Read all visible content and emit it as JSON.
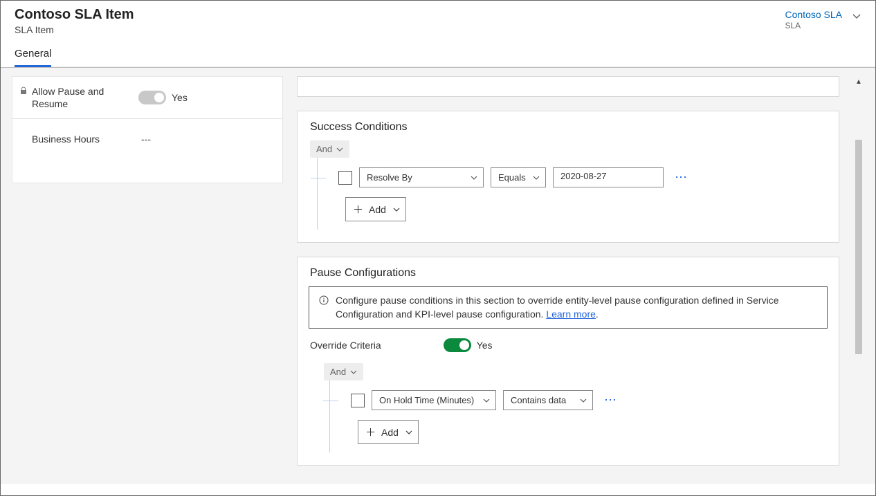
{
  "header": {
    "title": "Contoso SLA Item",
    "subtitle": "SLA Item",
    "sla_link": "Contoso SLA",
    "sla_type": "SLA"
  },
  "tabs": {
    "general": "General"
  },
  "side": {
    "allow_pause_label": "Allow Pause and Resume",
    "allow_pause_value": "Yes",
    "business_hours_label": "Business Hours",
    "business_hours_value": "---"
  },
  "success": {
    "title": "Success Conditions",
    "operator": "And",
    "field": "Resolve By",
    "comparator": "Equals",
    "value": "2020-08-27",
    "add": "Add"
  },
  "pause": {
    "title": "Pause Configurations",
    "info_text": "Configure pause conditions in this section to override entity-level pause configuration defined in Service Configuration and KPI-level pause configuration. ",
    "learn_more": "Learn more",
    "override_label": "Override Criteria",
    "override_value": "Yes",
    "operator": "And",
    "field": "On Hold Time (Minutes)",
    "comparator": "Contains data",
    "add": "Add"
  }
}
